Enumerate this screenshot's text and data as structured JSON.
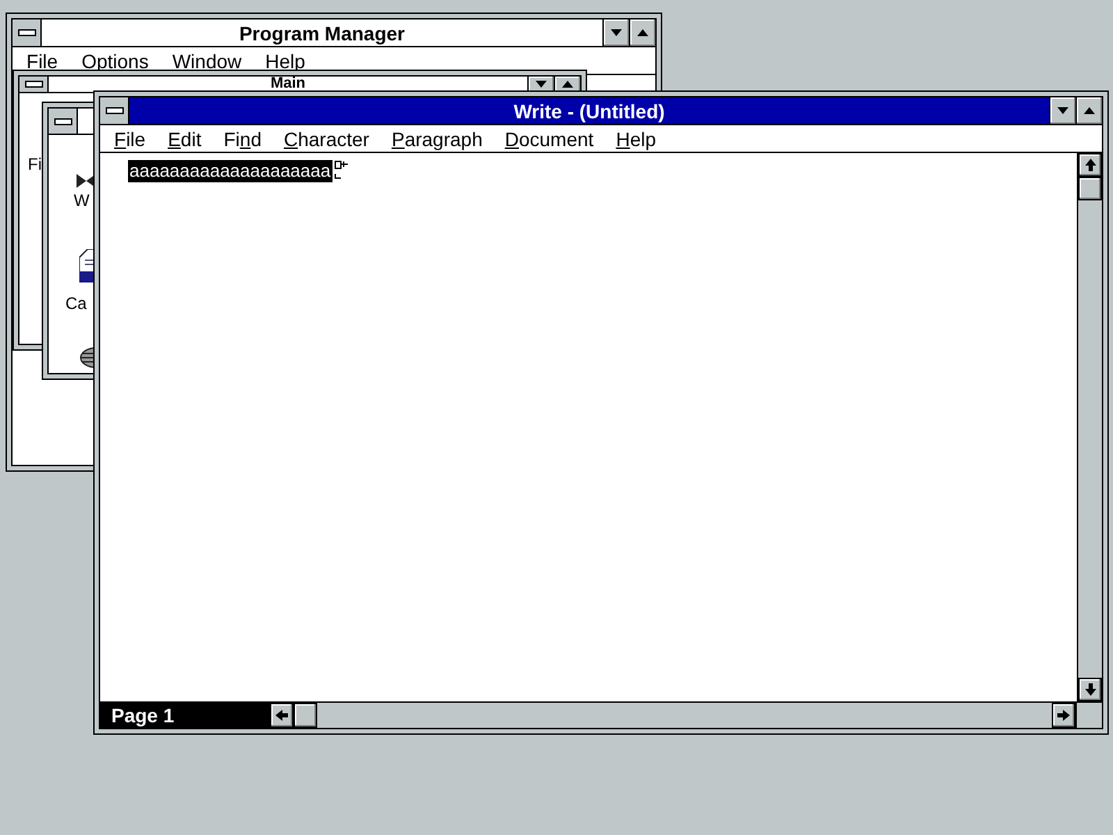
{
  "program_manager": {
    "title": "Program Manager",
    "active": false,
    "menu": [
      {
        "key": "F",
        "after": "ile"
      },
      {
        "key": "O",
        "after": "ptions"
      },
      {
        "key": "W",
        "after": "indow"
      },
      {
        "key": "H",
        "after": "elp"
      }
    ],
    "main_group": {
      "title": "Main",
      "icon_labels": [
        "Fi"
      ]
    },
    "group_window": {
      "icon_labels": [
        "W",
        "Ca"
      ]
    }
  },
  "write": {
    "title": "Write - (Untitled)",
    "active": true,
    "menu": [
      {
        "key": "F",
        "after": "ile"
      },
      {
        "key": "E",
        "after": "dit"
      },
      {
        "before": "Fi",
        "key": "n",
        "after": "d"
      },
      {
        "key": "C",
        "after": "haracter"
      },
      {
        "key": "P",
        "after": "aragraph"
      },
      {
        "key": "D",
        "after": "ocument"
      },
      {
        "key": "H",
        "after": "elp"
      }
    ],
    "document": {
      "text": "aaaaaaaaaaaaaaaaaaaa",
      "selected": true
    },
    "status": "Page 1"
  }
}
